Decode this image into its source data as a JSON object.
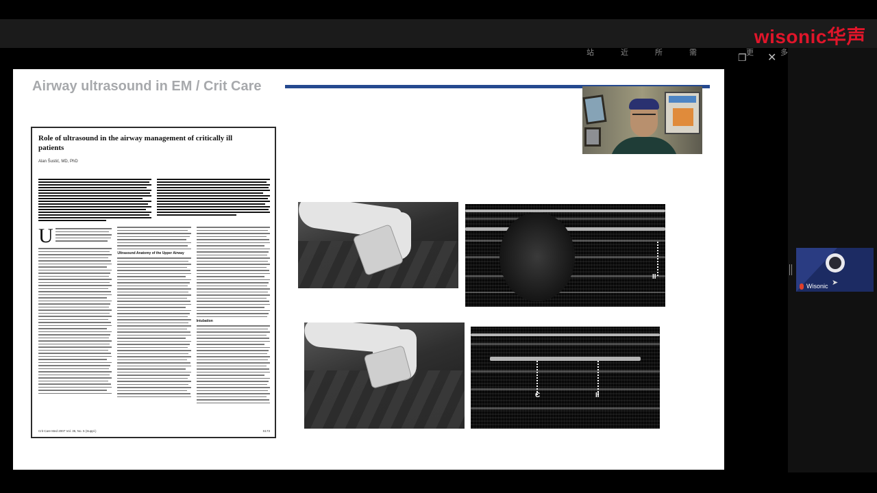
{
  "app": {
    "brand": "wisonic华声",
    "tagline": [
      "站　近　所　需",
      "更　多　关　爱"
    ]
  },
  "window_controls": [
    "restore-icon",
    "close-icon"
  ],
  "slide": {
    "title": "Airway ultrasound in EM / Crit Care",
    "paper": {
      "title": "Role of ultrasound in the airway management of critically ill patients",
      "author": "Alan Šustić, MD, PhD",
      "dropcap": "U",
      "section_heading_1": "Ultrasound Anatomy of the Upper Airway",
      "section_heading_2": "Intubation",
      "footer_left": "Crit Care Med 2007 Vol. 35, No. 5 (Suppl.)",
      "footer_right": "S173"
    },
    "us_markers": {
      "top_right": "II",
      "bottom_left": "C",
      "bottom_right": "II"
    }
  },
  "participant": {
    "name": "Wisonic"
  }
}
